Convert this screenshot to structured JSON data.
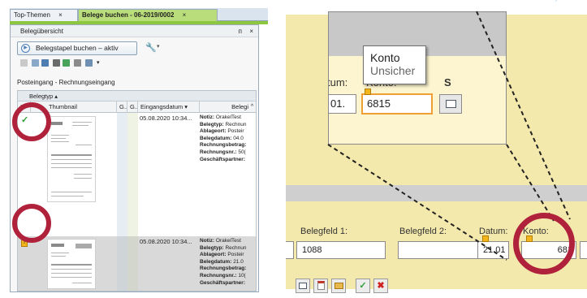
{
  "tabs": [
    {
      "label": "Top-Themen",
      "close": "×",
      "active": false
    },
    {
      "label": "Belege buchen - 06-2019/0002",
      "close": "×",
      "active": true
    }
  ],
  "panel": {
    "title": "Belegübersicht",
    "pin": "ᴨ",
    "close": "×",
    "stack_button_label": "Belegstapel buchen – aktiv",
    "toolbar_more": "▾",
    "breadcrumb": "Posteingang - Rechnungseingang"
  },
  "grid": {
    "group_label": "Belegtyp ▴",
    "columns": [
      "!",
      "Thumbnail",
      "G..",
      "G..",
      "Eingangsdatum ▾",
      "Belegi",
      "^"
    ],
    "rows": [
      {
        "status": "ok",
        "status_icon": "✓",
        "date": "05.08.2020 10:34...",
        "lines": [
          {
            "label": "Notiz:",
            "value": "OrakelTest"
          },
          {
            "label": "Belegtyp:",
            "value": "Rechnun"
          },
          {
            "label": "Ablageort:",
            "value": "Posteir"
          },
          {
            "label": "Belegdatum:",
            "value": "04.0"
          },
          {
            "label": "Rechnungsbetrag:",
            "value": ""
          },
          {
            "label": "Rechnungsnr.:",
            "value": "50("
          },
          {
            "label": "Geschäftspartner:",
            "value": ""
          }
        ]
      },
      {
        "status": "warning",
        "status_icon": "!",
        "date": "05.08.2020 10:34...",
        "lines": [
          {
            "label": "Notiz:",
            "value": "OrakelTest"
          },
          {
            "label": "Belegtyp:",
            "value": "Rechnun"
          },
          {
            "label": "Ablageort:",
            "value": "Posteir"
          },
          {
            "label": "Belegdatum:",
            "value": "21.0"
          },
          {
            "label": "Rechnungsbetrag:",
            "value": ""
          },
          {
            "label": "Rechnungsnr.:",
            "value": "10("
          },
          {
            "label": "Geschäftspartner:",
            "value": ""
          }
        ]
      }
    ]
  },
  "zoom": {
    "label_datum": "tum:",
    "label_konto": "Konto:",
    "label_s": "S",
    "datum_value": "01.",
    "konto_value": "6815",
    "tooltip_title": "Konto",
    "tooltip_sub": "Unsicher"
  },
  "form": {
    "belegfeld1_label": "Belegfeld 1:",
    "belegfeld2_label": "Belegfeld 2:",
    "datum_label": "Datum:",
    "konto_label": "Konto:",
    "left_value": "",
    "belegfeld1_value": "1088",
    "belegfeld2_value": "",
    "datum_value": "21.01",
    "konto_value": "681",
    "right_value": ""
  },
  "actions": {
    "ok": "✓",
    "cancel": "✖"
  },
  "colors": {
    "tab_active": "#b9dd7a",
    "accent_green": "#8dc63f",
    "highlight_red": "#b0223b",
    "form_background": "#f3e9ac",
    "warning": "#f2b61c",
    "active_border": "#f0a032"
  }
}
